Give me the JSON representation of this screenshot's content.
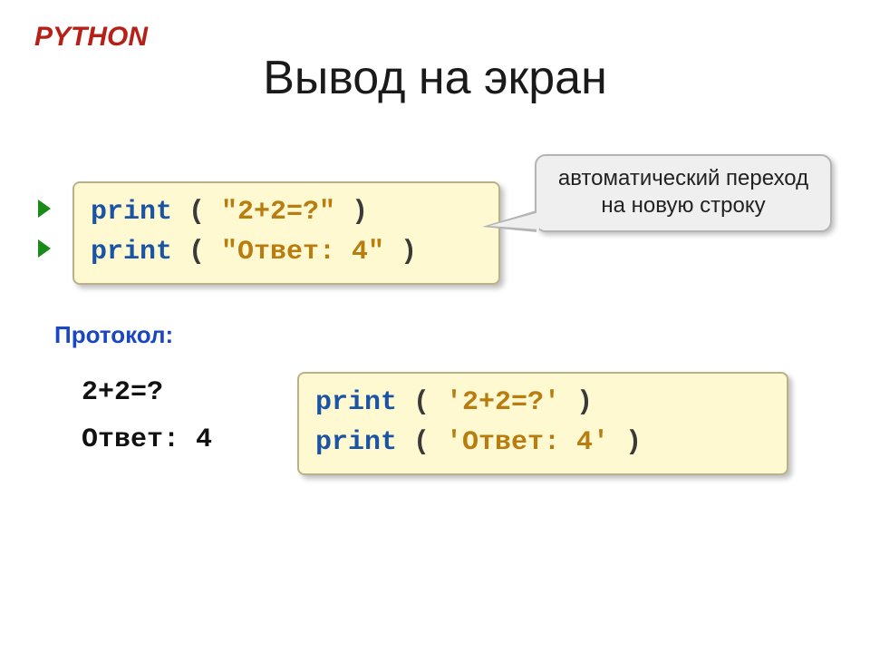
{
  "header": {
    "language": "PYTHON",
    "title": "Вывод на экран"
  },
  "code_box_1": {
    "line1_kw": "print",
    "line1_open": " ( ",
    "line1_str": "\"2+2=?\"",
    "line1_close": " )",
    "line2_kw": "print",
    "line2_open": " ( ",
    "line2_str": "\"Ответ: 4\"",
    "line2_close": " )"
  },
  "callout": {
    "text": "автоматический переход на новую строку"
  },
  "protocol": {
    "label": "Протокол:",
    "line1": "2+2=?",
    "line2": "Ответ: 4"
  },
  "code_box_2": {
    "line1_kw": "print",
    "line1_open": " ( ",
    "line1_str": "'2+2=?'",
    "line1_close": " )",
    "line2_kw": "print",
    "line2_open": " ( ",
    "line2_str": "'Ответ: 4'",
    "line2_close": " )"
  }
}
